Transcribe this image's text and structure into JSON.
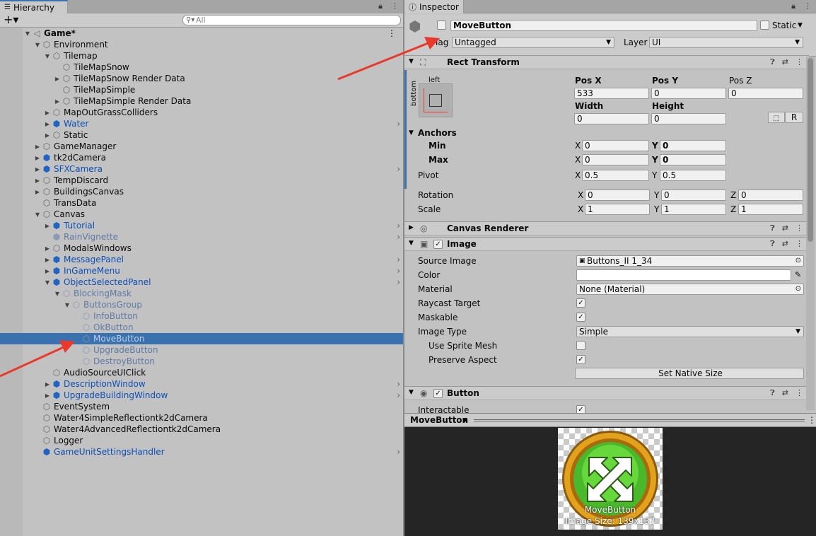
{
  "hierarchy": {
    "tab_label": "Hierarchy",
    "add_label": "+▾",
    "search_placeholder": "All",
    "rows": [
      {
        "label": "Game*",
        "indent": 0,
        "fold": "open",
        "icon": "unity",
        "style": "bold"
      },
      {
        "label": "Environment",
        "indent": 1,
        "fold": "open",
        "icon": "cube",
        "style": ""
      },
      {
        "label": "Tilemap",
        "indent": 2,
        "fold": "open",
        "icon": "cube",
        "style": ""
      },
      {
        "label": "TileMapSnow",
        "indent": 3,
        "fold": "",
        "icon": "cube",
        "style": ""
      },
      {
        "label": "TileMapSnow Render Data",
        "indent": 3,
        "fold": "closed",
        "icon": "cube",
        "style": ""
      },
      {
        "label": "TileMapSimple",
        "indent": 3,
        "fold": "",
        "icon": "cube",
        "style": ""
      },
      {
        "label": "TileMapSimple Render Data",
        "indent": 3,
        "fold": "closed",
        "icon": "cube",
        "style": ""
      },
      {
        "label": "MapOutGrassColliders",
        "indent": 2,
        "fold": "closed",
        "icon": "cube",
        "style": ""
      },
      {
        "label": "Water",
        "indent": 2,
        "fold": "closed",
        "icon": "prefab",
        "style": "blue",
        "chev": true
      },
      {
        "label": "Static",
        "indent": 2,
        "fold": "closed",
        "icon": "cube",
        "style": ""
      },
      {
        "label": "GameManager",
        "indent": 1,
        "fold": "closed",
        "icon": "cube",
        "style": ""
      },
      {
        "label": "tk2dCamera",
        "indent": 1,
        "fold": "closed",
        "icon": "prefab",
        "style": ""
      },
      {
        "label": "SFXCamera",
        "indent": 1,
        "fold": "closed",
        "icon": "prefab",
        "style": "blue",
        "chev": true
      },
      {
        "label": "TempDiscard",
        "indent": 1,
        "fold": "closed",
        "icon": "cube",
        "style": ""
      },
      {
        "label": "BuildingsCanvas",
        "indent": 1,
        "fold": "closed",
        "icon": "cube",
        "style": ""
      },
      {
        "label": "TransData",
        "indent": 1,
        "fold": "",
        "icon": "cube",
        "style": ""
      },
      {
        "label": "Canvas",
        "indent": 1,
        "fold": "open",
        "icon": "cube",
        "style": ""
      },
      {
        "label": "Tutorial",
        "indent": 2,
        "fold": "closed",
        "icon": "prefab",
        "style": "blue",
        "chev": true
      },
      {
        "label": "RainVignette",
        "indent": 2,
        "fold": "",
        "icon": "prefab-dim",
        "style": "dim",
        "chev": true
      },
      {
        "label": "ModalsWindows",
        "indent": 2,
        "fold": "closed",
        "icon": "cube",
        "style": ""
      },
      {
        "label": "MessagePanel",
        "indent": 2,
        "fold": "closed",
        "icon": "prefab",
        "style": "blue",
        "chev": true
      },
      {
        "label": "InGameMenu",
        "indent": 2,
        "fold": "closed",
        "icon": "prefab",
        "style": "blue",
        "chev": true
      },
      {
        "label": "ObjectSelectedPanel",
        "indent": 2,
        "fold": "open",
        "icon": "prefab",
        "style": "blue",
        "chev": true
      },
      {
        "label": "BlockingMask",
        "indent": 3,
        "fold": "open",
        "icon": "cube-dim",
        "style": "dim"
      },
      {
        "label": "ButtonsGroup",
        "indent": 4,
        "fold": "open",
        "icon": "cube-dim",
        "style": "dim"
      },
      {
        "label": "InfoButton",
        "indent": 5,
        "fold": "",
        "icon": "cube-dim",
        "style": "dim"
      },
      {
        "label": "OkButton",
        "indent": 5,
        "fold": "",
        "icon": "cube-dim",
        "style": "dim"
      },
      {
        "label": "MoveButton",
        "indent": 5,
        "fold": "",
        "icon": "cube-dim",
        "style": "dim",
        "selected": true
      },
      {
        "label": "UpgradeButton",
        "indent": 5,
        "fold": "",
        "icon": "cube-dim",
        "style": "dim"
      },
      {
        "label": "DestroyButton",
        "indent": 5,
        "fold": "",
        "icon": "cube-dim",
        "style": "dim"
      },
      {
        "label": "AudioSourceUIClick",
        "indent": 2,
        "fold": "",
        "icon": "cube",
        "style": ""
      },
      {
        "label": "DescriptionWindow",
        "indent": 2,
        "fold": "closed",
        "icon": "prefab",
        "style": "blue",
        "chev": true
      },
      {
        "label": "UpgradeBuildingWindow",
        "indent": 2,
        "fold": "closed",
        "icon": "prefab",
        "style": "blue",
        "chev": true
      },
      {
        "label": "EventSystem",
        "indent": 1,
        "fold": "",
        "icon": "cube",
        "style": ""
      },
      {
        "label": "Water4SimpleReflectiontk2dCamera",
        "indent": 1,
        "fold": "",
        "icon": "cube",
        "style": ""
      },
      {
        "label": "Water4AdvancedReflectiontk2dCamera",
        "indent": 1,
        "fold": "",
        "icon": "cube",
        "style": ""
      },
      {
        "label": "Logger",
        "indent": 1,
        "fold": "",
        "icon": "cube",
        "style": ""
      },
      {
        "label": "GameUnitSettingsHandler",
        "indent": 1,
        "fold": "",
        "icon": "prefab",
        "style": "blue",
        "chev": true
      }
    ]
  },
  "inspector": {
    "tab_label": "Inspector",
    "object_name": "MoveButton",
    "static_label": "Static",
    "tag_label": "Tag",
    "tag_value": "Untagged",
    "layer_label": "Layer",
    "layer_value": "UI",
    "rect_transform": {
      "title": "Rect Transform",
      "anchor_h": "left",
      "anchor_v": "bottom",
      "pos_x_label": "Pos X",
      "pos_x": "533",
      "pos_y_label": "Pos Y",
      "pos_y": "0",
      "pos_z_label": "Pos Z",
      "pos_z": "0",
      "width_label": "Width",
      "width": "0",
      "height_label": "Height",
      "height": "0",
      "r_button": "R",
      "anchors_label": "Anchors",
      "min_label": "Min",
      "min_x": "0",
      "min_y": "0",
      "max_label": "Max",
      "max_x": "0",
      "max_y": "0",
      "pivot_label": "Pivot",
      "pivot_x": "0.5",
      "pivot_y": "0.5",
      "rotation_label": "Rotation",
      "rot_x": "0",
      "rot_y": "0",
      "rot_z": "0",
      "scale_label": "Scale",
      "scale_x": "1",
      "scale_y": "1",
      "scale_z": "1",
      "x": "X",
      "y": "Y",
      "z": "Z"
    },
    "canvas_renderer": {
      "title": "Canvas Renderer"
    },
    "image": {
      "title": "Image",
      "source_image_label": "Source Image",
      "source_image": "Buttons_II 1_34",
      "color_label": "Color",
      "material_label": "Material",
      "material": "None (Material)",
      "raycast_label": "Raycast Target",
      "maskable_label": "Maskable",
      "image_type_label": "Image Type",
      "image_type": "Simple",
      "sprite_mesh_label": "Use Sprite Mesh",
      "preserve_aspect_label": "Preserve Aspect",
      "native_size_button": "Set Native Size"
    },
    "button": {
      "title": "Button",
      "interactable_label": "Interactable"
    },
    "preview": {
      "dropdown": "MoveButton",
      "name": "MoveButton",
      "size": "Image Size: 139x137"
    }
  },
  "colors": {
    "selection": "#3a72b0",
    "prefab_blue": "#0d4fb4",
    "arrow_red": "#e8392a"
  }
}
